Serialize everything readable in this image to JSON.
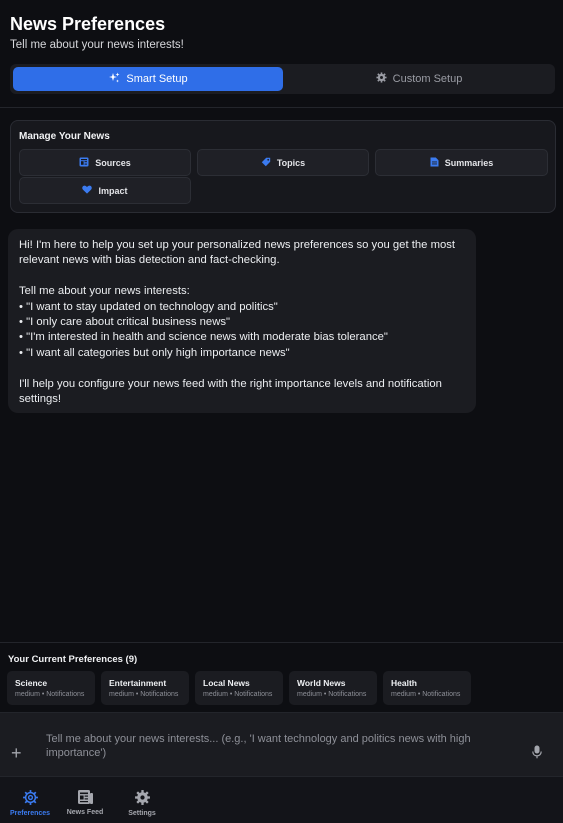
{
  "header": {
    "title": "News Preferences",
    "subtitle": "Tell me about your news interests!"
  },
  "segmented": {
    "smart_label": "Smart Setup",
    "custom_label": "Custom Setup"
  },
  "manage": {
    "title": "Manage Your News",
    "buttons": [
      "Sources",
      "Topics",
      "Summaries",
      "Impact"
    ]
  },
  "chat": {
    "intro": "Hi! I'm here to help you set up your personalized news preferences so you get the most relevant news with bias detection and fact-checking.",
    "prompt": "Tell me about your news interests:",
    "examples": [
      "• \"I want to stay updated on technology and politics\"",
      "• \"I only care about critical business news\"",
      "• \"I'm interested in health and science news with moderate bias tolerance\"",
      "• \"I want all categories but only high importance news\""
    ],
    "outro": "I'll help you configure your news feed with the right importance levels and notification settings!"
  },
  "preferences": {
    "title": "Your Current Preferences (9)",
    "items": [
      {
        "name": "Science",
        "meta": "medium • Notifications"
      },
      {
        "name": "Entertainment",
        "meta": "medium • Notifications"
      },
      {
        "name": "Local News",
        "meta": "medium • Notifications"
      },
      {
        "name": "World News",
        "meta": "medium • Notifications"
      },
      {
        "name": "Health",
        "meta": "medium • Notifications"
      }
    ]
  },
  "composer": {
    "placeholder": "Tell me about your news interests... (e.g., 'I want technology and politics news with high importance')"
  },
  "nav": {
    "items": [
      "Preferences",
      "News Feed",
      "Settings"
    ]
  },
  "colors": {
    "accent": "#2f6ee8",
    "background": "#0d0e12",
    "card": "#1b1c21"
  }
}
